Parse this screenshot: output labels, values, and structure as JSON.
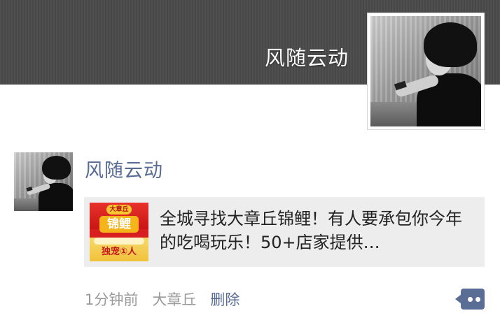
{
  "profile": {
    "name": "风随云动"
  },
  "post": {
    "author": "风随云动",
    "link": {
      "title": "全城寻找大章丘锦鲤！有人要承包你今年的吃喝玩乐！50+店家提供…",
      "thumbnail": {
        "badge": "大章丘",
        "title": "锦鲤",
        "caption": "独宠①人"
      }
    },
    "meta": {
      "time": "1分钟前",
      "location": "大章丘",
      "delete_label": "删除"
    },
    "more_icon": "comment-dots-icon"
  }
}
